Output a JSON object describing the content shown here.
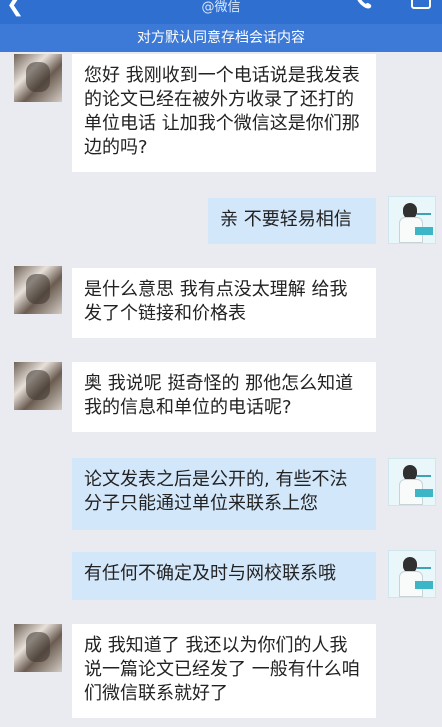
{
  "header": {
    "back_icon": "chevron-left-icon",
    "subtitle": "@微信",
    "call_icon": "phone-icon",
    "more_icon": "more-icon",
    "notice": "对方默认同意存档会话内容"
  },
  "messages": [
    {
      "side": "left",
      "text": "您好 我刚收到一个电话说是我发表的论文已经在被外方收录了还打的单位电话 让加我个微信这是你们那边的吗?"
    },
    {
      "side": "right",
      "text": "亲 不要轻易相信"
    },
    {
      "side": "left",
      "text": "是什么意思 我有点没太理解 给我发了个链接和价格表"
    },
    {
      "side": "left",
      "text": "奥 我说呢 挺奇怪的 那他怎么知道我的信息和单位的电话呢?"
    },
    {
      "side": "right",
      "text": "论文发表之后是公开的, 有些不法分子只能通过单位来联系上您"
    },
    {
      "side": "right",
      "text": "有任何不确定及时与网校联系哦"
    },
    {
      "side": "left",
      "text": "成 我知道了 我还以为你们的人我说一篇论文已经发了 一般有什么咱们微信联系就好了"
    }
  ],
  "colors": {
    "header_bg": "#2f6fd0",
    "notice_bg": "#3d7ad7",
    "chat_bg": "#e9ebf0",
    "bubble_left": "#ffffff",
    "bubble_right": "#d3e7fb"
  }
}
